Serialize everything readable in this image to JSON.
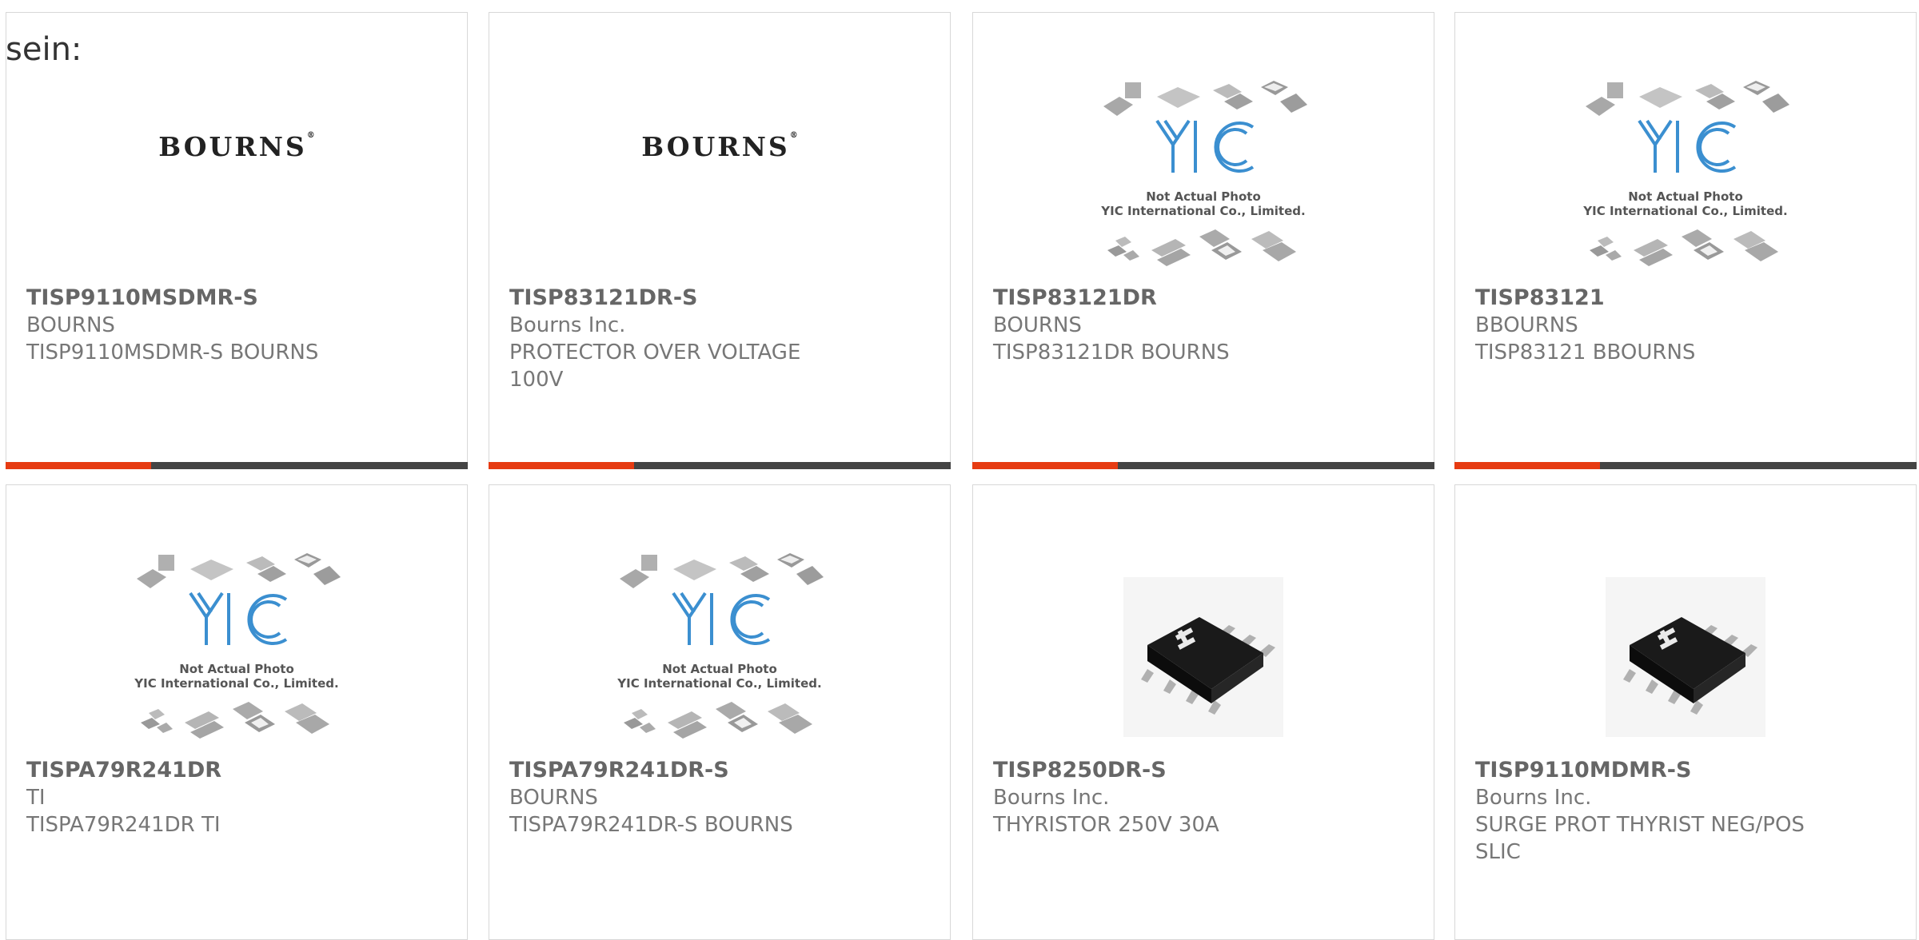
{
  "intro_text": "sein:",
  "colors": {
    "accent": "#e63b12",
    "bar": "#444444",
    "border": "#d8d8d8",
    "text": "#666666"
  },
  "products": [
    {
      "part": "TISP9110MSDMR-S",
      "maker": "BOURNS",
      "desc": "TISP9110MSDMR-S BOURNS",
      "image": "bourns-logo",
      "logo_text": "BOURNS",
      "logo_mark": "®"
    },
    {
      "part": "TISP83121DR-S",
      "maker": "Bourns Inc.",
      "desc": "PROTECTOR OVER VOLTAGE 100V",
      "image": "bourns-logo",
      "logo_text": "BOURNS",
      "logo_mark": "®"
    },
    {
      "part": "TISP83121DR",
      "maker": "BOURNS",
      "desc": "TISP83121DR BOURNS",
      "image": "yic-placeholder",
      "ph_line1": "Not Actual Photo",
      "ph_line2": "YIC International Co., Limited."
    },
    {
      "part": "TISP83121",
      "maker": "BBOURNS",
      "desc": "TISP83121 BBOURNS",
      "image": "yic-placeholder",
      "ph_line1": "Not Actual Photo",
      "ph_line2": "YIC International Co., Limited."
    },
    {
      "part": "TISPA79R241DR",
      "maker": "TI",
      "desc": "TISPA79R241DR TI",
      "image": "yic-placeholder",
      "ph_line1": "Not Actual Photo",
      "ph_line2": "YIC International Co., Limited."
    },
    {
      "part": "TISPA79R241DR-S",
      "maker": "BOURNS",
      "desc": "TISPA79R241DR-S BOURNS",
      "image": "yic-placeholder",
      "ph_line1": "Not Actual Photo",
      "ph_line2": "YIC International Co., Limited."
    },
    {
      "part": "TISP8250DR-S",
      "maker": "Bourns Inc.",
      "desc": "THYRISTOR 250V 30A",
      "image": "soic-chip"
    },
    {
      "part": "TISP9110MDMR-S",
      "maker": "Bourns Inc.",
      "desc": "SURGE PROT THYRIST NEG/POS SLIC",
      "image": "soic-chip"
    }
  ]
}
